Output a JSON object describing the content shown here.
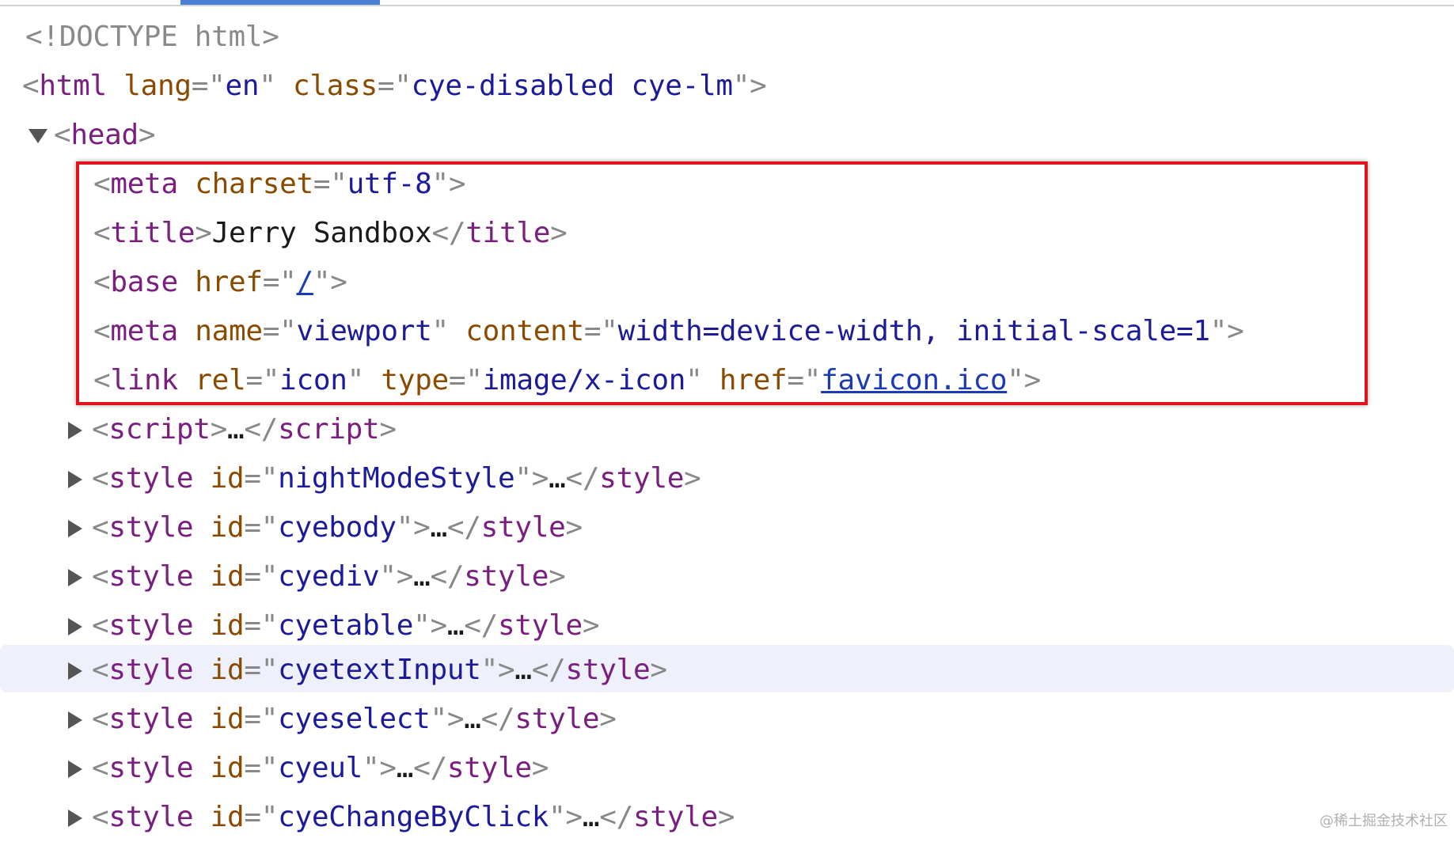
{
  "doctype": "<!DOCTYPE html>",
  "html_open": {
    "tag": "html",
    "attr1": "lang",
    "val1": "en",
    "attr2": "class",
    "val2": "cye-disabled cye-lm"
  },
  "head_open": {
    "tag": "head"
  },
  "highlighted_block": [
    {
      "tag": "meta",
      "attr": "charset",
      "val": "utf-8"
    },
    {
      "tag": "title",
      "text": "Jerry Sandbox"
    },
    {
      "tag": "base",
      "attr": "href",
      "val": "/"
    },
    {
      "tag": "meta",
      "attr1": "name",
      "val1": "viewport",
      "attr2": "content",
      "val2": "width=device-width, initial-scale=1"
    },
    {
      "tag": "link",
      "attr1": "rel",
      "val1": "icon",
      "attr2": "type",
      "val2": "image/x-icon",
      "attr3": "href",
      "val3": "favicon.ico"
    }
  ],
  "collapsed_nodes": [
    {
      "tag": "script",
      "id": ""
    },
    {
      "tag": "style",
      "id": "nightModeStyle"
    },
    {
      "tag": "style",
      "id": "cyebody"
    },
    {
      "tag": "style",
      "id": "cyediv"
    },
    {
      "tag": "style",
      "id": "cyetable"
    },
    {
      "tag": "style",
      "id": "cyetextInput"
    },
    {
      "tag": "style",
      "id": "cyeselect"
    },
    {
      "tag": "style",
      "id": "cyeul"
    },
    {
      "tag": "style",
      "id": "cyeChangeByClick"
    }
  ],
  "ellipsis": "…",
  "id_attr": "id",
  "watermark": "@稀土掘金技术社区",
  "colors": {
    "highlight_box": "#e0141c",
    "hover_row": "#eef0fb",
    "active_tab": "#4a7fd6"
  }
}
